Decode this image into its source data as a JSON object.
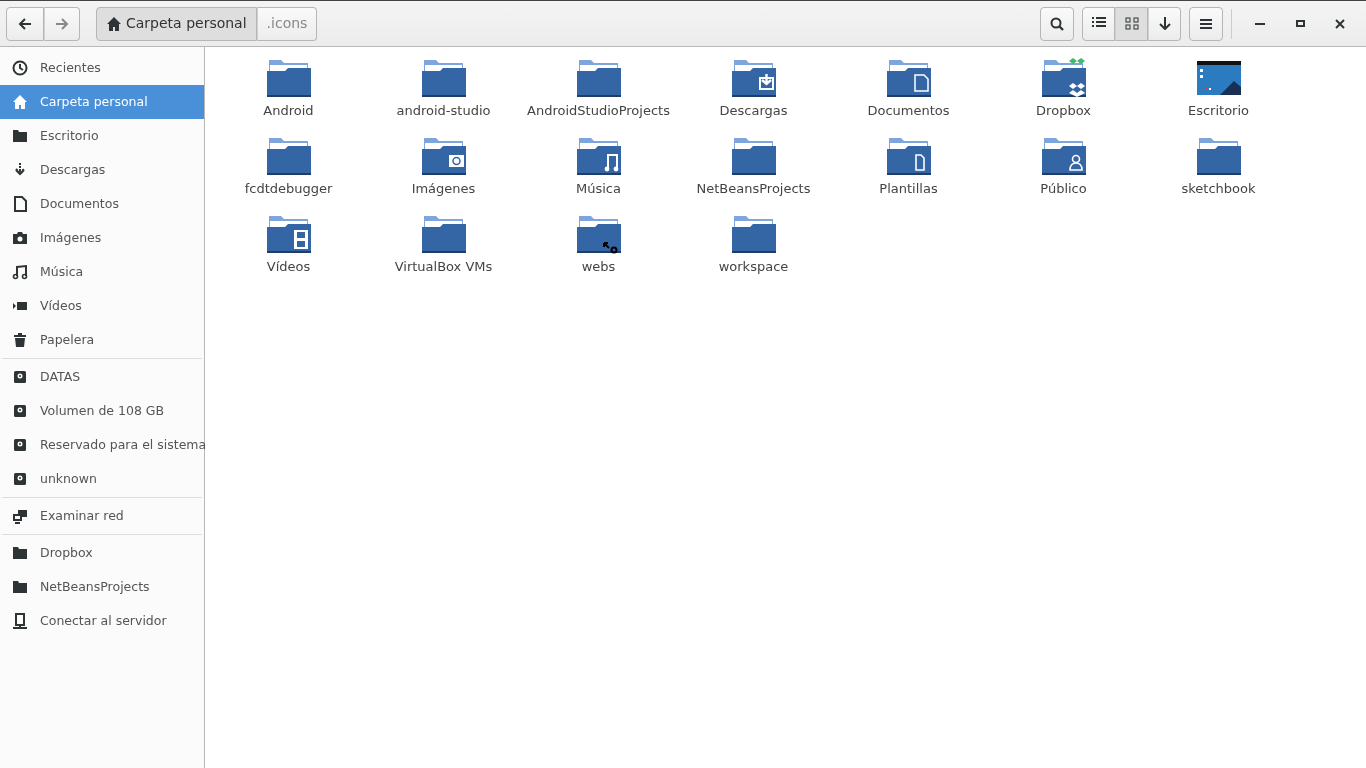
{
  "toolbar": {
    "path": [
      {
        "label": "Carpeta personal",
        "kind": "home",
        "selected": true
      },
      {
        "label": ".icons",
        "kind": "plain",
        "selected": false
      }
    ],
    "view_buttons": [
      {
        "kind": "list",
        "selected": false
      },
      {
        "kind": "grid",
        "selected": true
      },
      {
        "kind": "sort",
        "selected": false
      }
    ]
  },
  "sidebar": {
    "sections": [
      {
        "items": [
          {
            "label": "Recientes",
            "kind": "clock",
            "selected": false
          },
          {
            "label": "Carpeta personal",
            "kind": "home",
            "selected": true
          },
          {
            "label": "Escritorio",
            "kind": "folder",
            "selected": false
          },
          {
            "label": "Descargas",
            "kind": "download",
            "selected": false
          },
          {
            "label": "Documentos",
            "kind": "document",
            "selected": false
          },
          {
            "label": "Imágenes",
            "kind": "camera",
            "selected": false
          },
          {
            "label": "Música",
            "kind": "music",
            "selected": false
          },
          {
            "label": "Vídeos",
            "kind": "video",
            "selected": false
          },
          {
            "label": "Papelera",
            "kind": "trash",
            "selected": false
          }
        ]
      },
      {
        "items": [
          {
            "label": "DATAS",
            "kind": "drive",
            "selected": false
          },
          {
            "label": "Volumen de 108 GB",
            "kind": "drive",
            "selected": false
          },
          {
            "label": "Reservado para el sistema",
            "kind": "drive",
            "selected": false
          },
          {
            "label": "unknown",
            "kind": "drive",
            "selected": false
          }
        ]
      },
      {
        "items": [
          {
            "label": "Examinar red",
            "kind": "network",
            "selected": false
          }
        ]
      },
      {
        "items": [
          {
            "label": "Dropbox",
            "kind": "folder",
            "selected": false
          },
          {
            "label": "NetBeansProjects",
            "kind": "folder",
            "selected": false
          },
          {
            "label": "Conectar al servidor",
            "kind": "server",
            "selected": false
          }
        ]
      }
    ]
  },
  "files": [
    {
      "name": "Android",
      "kind": "plain"
    },
    {
      "name": "android-studio",
      "kind": "plain"
    },
    {
      "name": "AndroidStudioProjects",
      "kind": "plain"
    },
    {
      "name": "Descargas",
      "kind": "download"
    },
    {
      "name": "Documentos",
      "kind": "document"
    },
    {
      "name": "Dropbox",
      "kind": "dropbox"
    },
    {
      "name": "Escritorio",
      "kind": "desktop"
    },
    {
      "name": "fcdtdebugger",
      "kind": "plain"
    },
    {
      "name": "Imágenes",
      "kind": "camera"
    },
    {
      "name": "Música",
      "kind": "music"
    },
    {
      "name": "NetBeansProjects",
      "kind": "plain"
    },
    {
      "name": "Plantillas",
      "kind": "template"
    },
    {
      "name": "Público",
      "kind": "public"
    },
    {
      "name": "sketchbook",
      "kind": "plain"
    },
    {
      "name": "Vídeos",
      "kind": "video"
    },
    {
      "name": "VirtualBox VMs",
      "kind": "plain"
    },
    {
      "name": "webs",
      "kind": "link"
    },
    {
      "name": "workspace",
      "kind": "plain"
    }
  ]
}
